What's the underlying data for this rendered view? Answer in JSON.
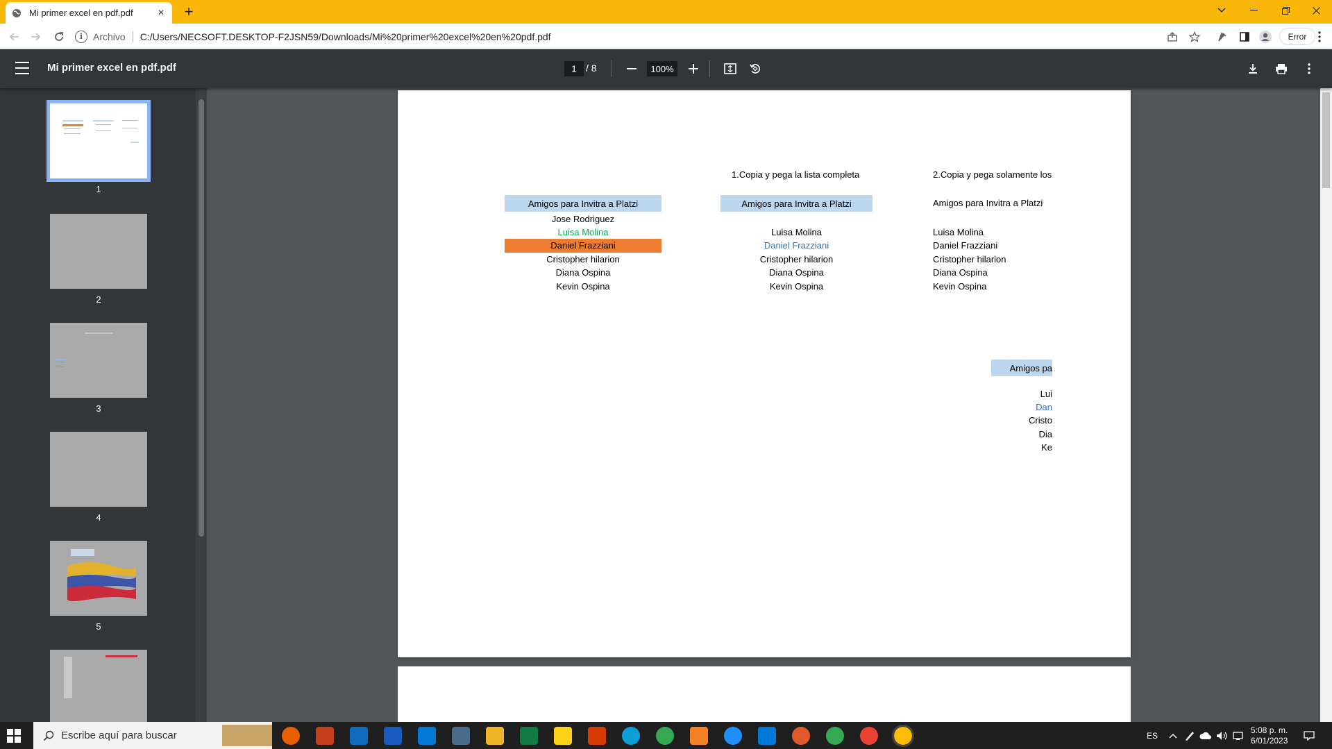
{
  "browser": {
    "tab_title": "Mi primer excel en pdf.pdf",
    "tab_close": "×",
    "new_tab": "+",
    "origin_label": "Archivo",
    "url": "C:/Users/NECSOFT.DESKTOP-F2JSN59/Downloads/Mi%20primer%20excel%20en%20pdf.pdf",
    "profile_error": "Error"
  },
  "pdf_toolbar": {
    "title": "Mi primer excel en pdf.pdf",
    "current_page": "1",
    "total_pages": "/  8",
    "zoom": "100%"
  },
  "thumbnails": [
    {
      "number": "1"
    },
    {
      "number": "2"
    },
    {
      "number": "3"
    },
    {
      "number": "4"
    },
    {
      "number": "5"
    }
  ],
  "page": {
    "instruction_1": "1.Copia y pega la lista completa",
    "instruction_2": "2.Copia y pega solamente los",
    "table1": {
      "header": "Amigos para Invitra a Platzi",
      "rows": [
        "Jose Rodriguez",
        "Luisa Molina",
        "Daniel Frazziani",
        "Cristopher hilarion",
        "Diana Ospina",
        "Kevin Ospina"
      ]
    },
    "table2": {
      "header": "Amigos para Invitra a Platzi",
      "rows": [
        "Luisa Molina",
        "Daniel Frazziani",
        "Cristopher hilarion",
        "Diana Ospina",
        "Kevin Ospina"
      ]
    },
    "table3": {
      "header": "Amigos para Invitra a Platzi",
      "rows": [
        "Luisa Molina",
        "Daniel Frazziani",
        "Cristopher hilarion",
        "Diana Ospina",
        "Kevin Ospina"
      ]
    },
    "table4": {
      "header": "Amigos pa",
      "rows": [
        "Lui",
        "Dan",
        "Cristo",
        "Dia",
        "Ke"
      ]
    },
    "colors": {
      "header_fill": "#bdd7ee",
      "highlight_fill": "#ed7d31",
      "green_text": "#00b050",
      "blue_text": "#2e75b6"
    }
  },
  "taskbar": {
    "search_placeholder": "Escribe aquí para buscar",
    "language": "ES",
    "time": "5:08 p. m.",
    "date": "6/01/2023"
  }
}
